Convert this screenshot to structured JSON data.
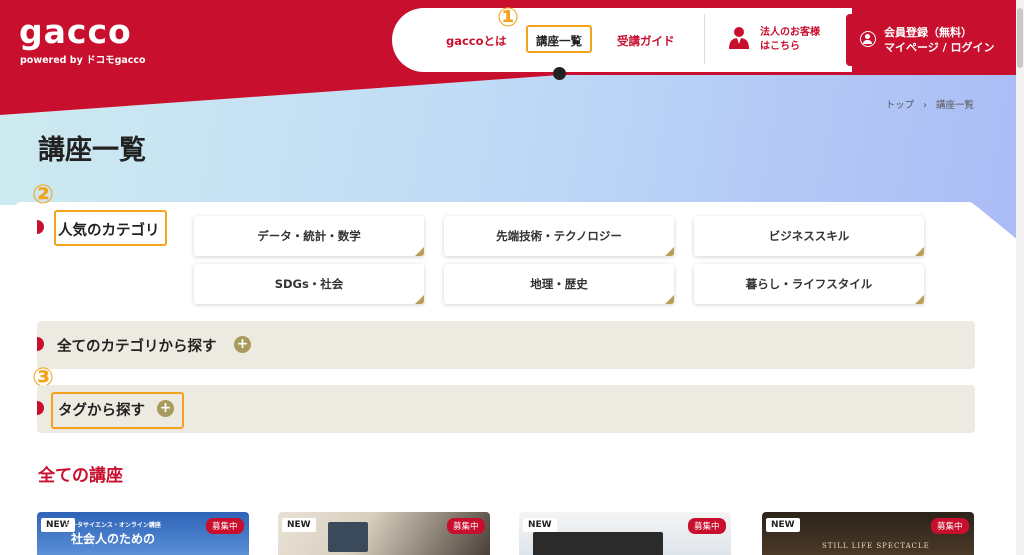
{
  "header": {
    "logo": "gacco",
    "logo_sub": "powered by ドコモgacco",
    "nav": [
      "gaccoとは",
      "講座一覧",
      "受講ガイド"
    ],
    "corporate": [
      "法人のお客様",
      "はこちら"
    ],
    "login": [
      "会員登録（無料）",
      "マイページ / ログイン"
    ]
  },
  "breadcrumb": {
    "home": "トップ",
    "sep": "›",
    "current": "講座一覧"
  },
  "page_title": "講座一覧",
  "popular": {
    "label": "人気のカテゴリ",
    "categories": [
      "データ・統計・数学",
      "先端技術・テクノロジー",
      "ビジネススキル",
      "SDGs・社会",
      "地理・歴史",
      "暮らし・ライフスタイル"
    ]
  },
  "all_categories_label": "全てのカテゴリから探す",
  "tags_label": "タグから探す",
  "plus_symbol": "+",
  "annotations": [
    "①",
    "②",
    "③"
  ],
  "all_courses_title": "全ての講座",
  "courses": [
    {
      "badge_new": "NEW",
      "badge_status": "募集中",
      "thumb_title_small": "データサイエンス・オンライン講座",
      "thumb_title": "社会人のための"
    },
    {
      "badge_new": "NEW",
      "badge_status": "募集中"
    },
    {
      "badge_new": "NEW",
      "badge_status": "募集中"
    },
    {
      "badge_new": "NEW",
      "badge_status": "募集中",
      "thumb_title": "STILL LIFE SPECTACLE"
    }
  ],
  "colors": {
    "brand": "#c8102e",
    "highlight": "#f3a21c",
    "accent": "#a99b5e"
  }
}
